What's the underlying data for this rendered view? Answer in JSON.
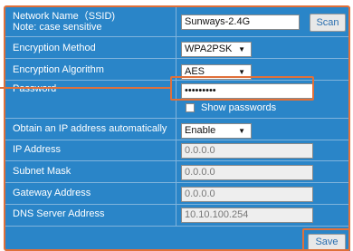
{
  "ssid": {
    "label_line1": "Network Name（SSID)",
    "label_line2": "Note: case sensitive",
    "value": "Sunways-2.4G",
    "scan_label": "Scan"
  },
  "encryption_method": {
    "label": "Encryption Method",
    "value": "WPA2PSK"
  },
  "encryption_algorithm": {
    "label": "Encryption Algorithm",
    "value": "AES"
  },
  "password": {
    "label": "Password",
    "value": "•••••••••",
    "show_label": "Show passwords"
  },
  "dhcp": {
    "label": "Obtain an IP address automatically",
    "value": "Enable"
  },
  "ip_address": {
    "label": "IP Address",
    "value": "0.0.0.0"
  },
  "subnet_mask": {
    "label": "Subnet Mask",
    "value": "0.0.0.0"
  },
  "gateway": {
    "label": "Gateway Address",
    "value": "0.0.0.0"
  },
  "dns": {
    "label": "DNS Server Address",
    "value": "10.10.100.254"
  },
  "save_label": "Save",
  "colors": {
    "panel": "#2a85c8",
    "highlight": "#e0703a"
  }
}
